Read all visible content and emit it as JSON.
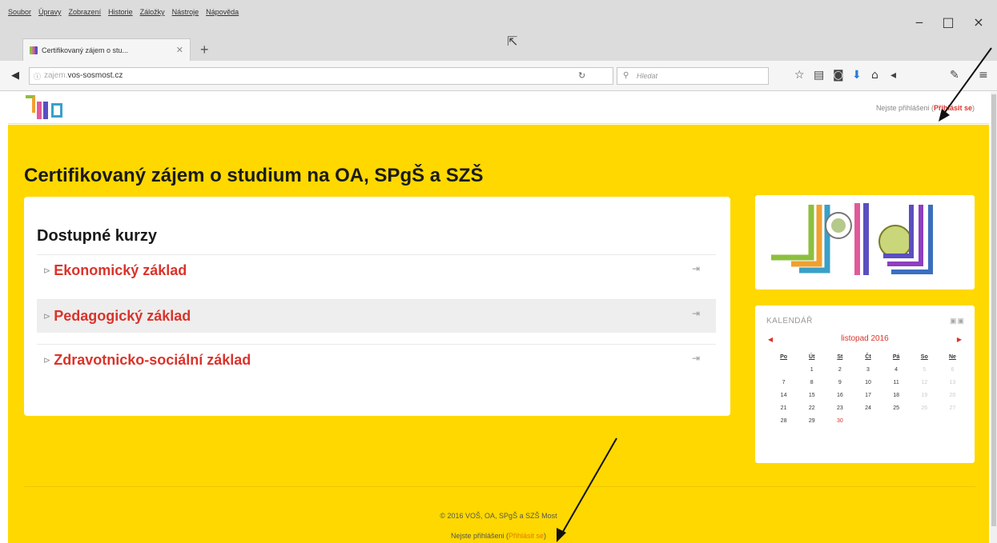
{
  "browser": {
    "menu": [
      "Soubor",
      "Úpravy",
      "Zobrazení",
      "Historie",
      "Záložky",
      "Nástroje",
      "Nápověda"
    ],
    "tab_title": "Certifikovaný zájem o stu...",
    "tab_close": "✕",
    "new_tab": "+",
    "url_dim": "zajem.",
    "url_main": "vos-sosmost.cz",
    "search_placeholder": "Hledat",
    "min": "‒",
    "max": "□",
    "close": "×"
  },
  "header": {
    "login_text": "Nejste přihlášeni (",
    "login_link": "Přihlásit se",
    "login_close": ")"
  },
  "page": {
    "title": "Certifikovaný zájem o studium na OA, SPgŠ a SZŠ"
  },
  "courses": {
    "heading": "Dostupné kurzy",
    "items": [
      {
        "name": "Ekonomický základ"
      },
      {
        "name": "Pedagogický základ"
      },
      {
        "name": "Zdravotnicko-sociální základ"
      }
    ]
  },
  "calendar": {
    "title": "KALENDÁŘ",
    "month": "listopad 2016",
    "days": [
      "Po",
      "Út",
      "St",
      "Čt",
      "Pá",
      "So",
      "Ne"
    ],
    "weeks": [
      [
        "",
        "1",
        "2",
        "3",
        "4",
        "5",
        "6"
      ],
      [
        "7",
        "8",
        "9",
        "10",
        "11",
        "12",
        "13"
      ],
      [
        "14",
        "15",
        "16",
        "17",
        "18",
        "19",
        "20"
      ],
      [
        "21",
        "22",
        "23",
        "24",
        "25",
        "26",
        "27"
      ],
      [
        "28",
        "29",
        "30",
        "",
        "",
        "",
        ""
      ]
    ],
    "today": "30"
  },
  "footer": {
    "copyright": "© 2016 VOŠ, OA, SPgŠ a SZŠ Most",
    "login_text": "Nejste přihlášeni (",
    "login_link": "Přihlásit se",
    "login_close": ")"
  },
  "colors": {
    "page_bg": "#ffd800",
    "link": "#d9342b"
  }
}
